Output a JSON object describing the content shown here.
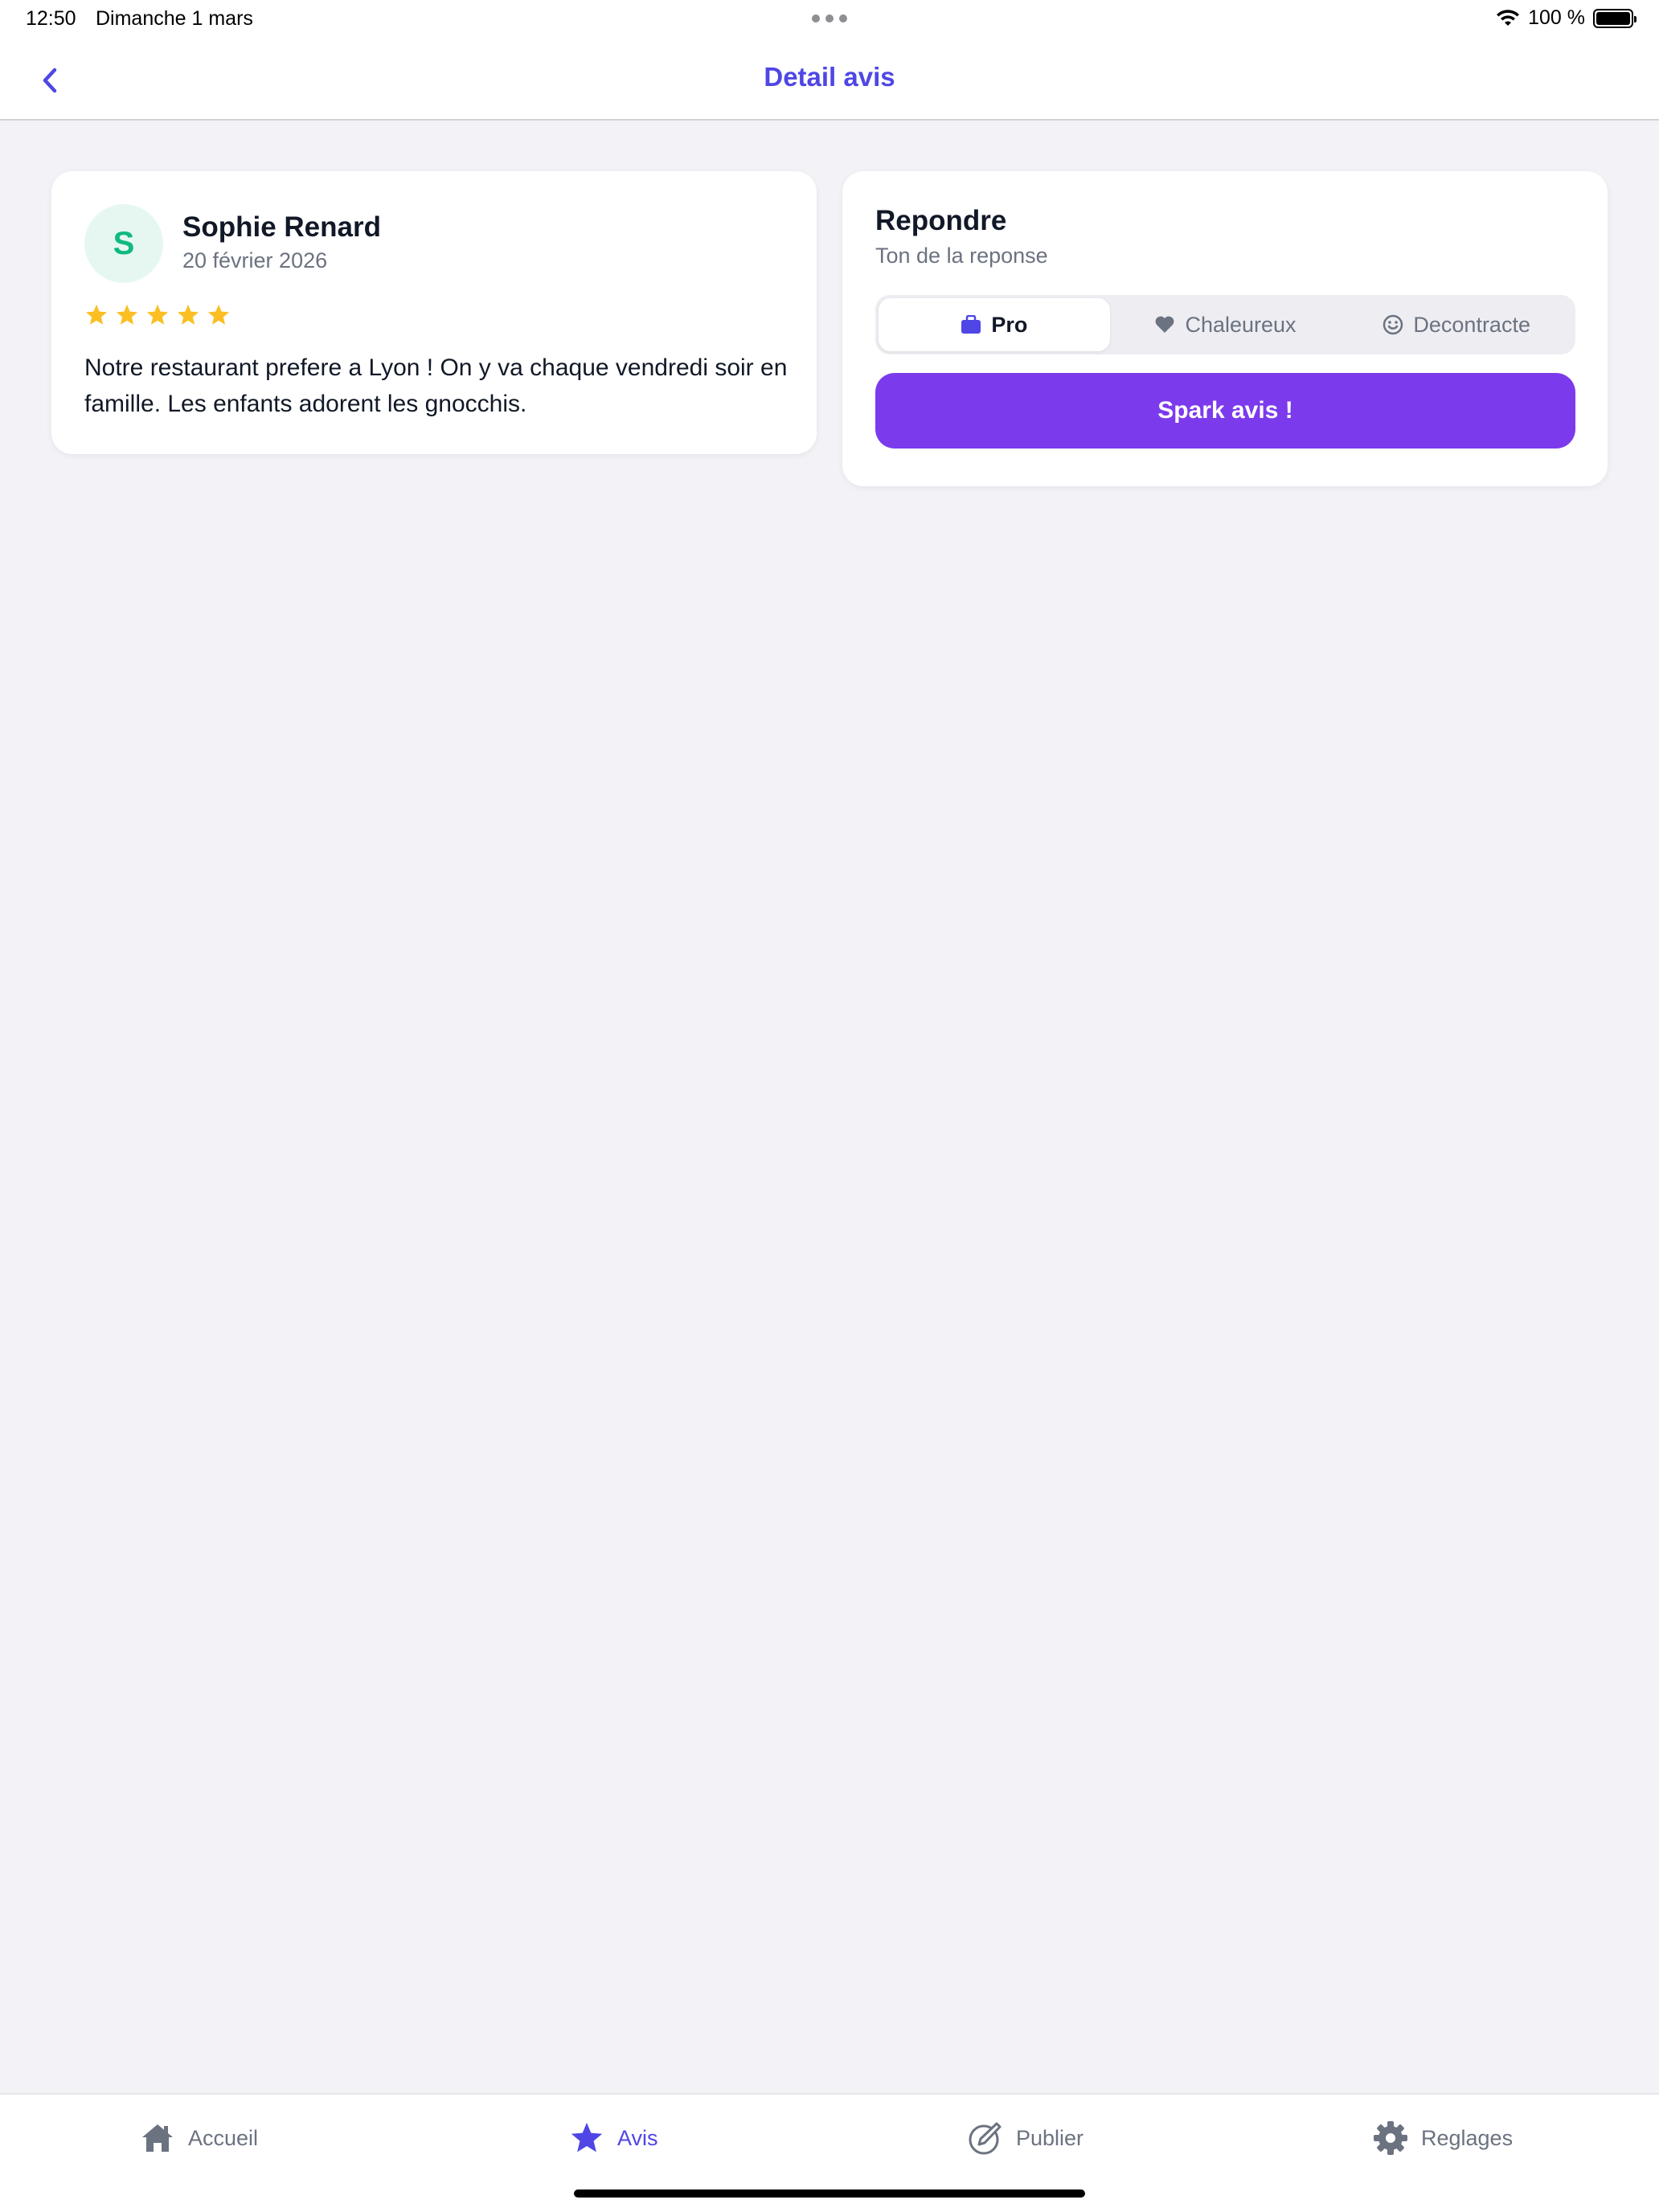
{
  "status_bar": {
    "time": "12:50",
    "date": "Dimanche 1 mars",
    "battery": "100 %"
  },
  "nav": {
    "title": "Detail avis",
    "back_icon": "chevron-left-icon"
  },
  "review": {
    "avatar_initial": "S",
    "name": "Sophie Renard",
    "date": "20 février 2026",
    "rating": 5,
    "rating_max": 5,
    "text": "Notre restaurant prefere a Lyon ! On y va chaque vendredi soir en famille. Les enfants adorent les gnocchis."
  },
  "reply": {
    "title": "Repondre",
    "subtitle": "Ton de la reponse",
    "tones": [
      {
        "label": "Pro",
        "icon": "briefcase-icon",
        "selected": true
      },
      {
        "label": "Chaleureux",
        "icon": "heart-icon",
        "selected": false
      },
      {
        "label": "Decontracte",
        "icon": "smiley-icon",
        "selected": false
      }
    ],
    "button_label": "Spark avis !"
  },
  "tabbar": {
    "items": [
      {
        "label": "Accueil",
        "icon": "home-icon",
        "active": false
      },
      {
        "label": "Avis",
        "icon": "star-icon",
        "active": true
      },
      {
        "label": "Publier",
        "icon": "compose-icon",
        "active": false
      },
      {
        "label": "Reglages",
        "icon": "gear-icon",
        "active": false
      }
    ]
  },
  "colors": {
    "accent": "#4f46e5",
    "button": "#7c3aed",
    "star": "#fbbf24",
    "avatar_text": "#10b981",
    "avatar_bg": "#e6f7f1",
    "background": "#f2f2f7"
  }
}
